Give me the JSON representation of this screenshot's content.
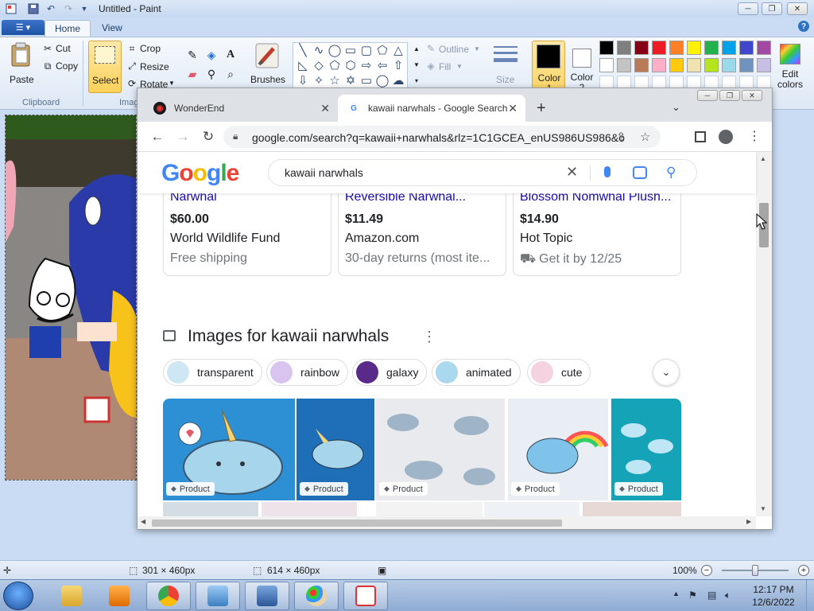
{
  "paint": {
    "title": "Untitled - Paint",
    "tabs": {
      "home": "Home",
      "view": "View"
    },
    "clipboard": {
      "paste": "Paste",
      "cut": "Cut",
      "copy": "Copy",
      "group": "Clipboard"
    },
    "image": {
      "select": "Select",
      "crop": "Crop",
      "resize": "Resize",
      "rotate": "Rotate",
      "group": "Imag"
    },
    "brushes": "Brushes",
    "outline": "Outline",
    "fill": "Fill",
    "size": "Size",
    "color1": "Color 1",
    "color2": "Color 2",
    "edit_colors": "Edit colors",
    "palette_row1": [
      "#000000",
      "#7f7f7f",
      "#880015",
      "#ed1c24",
      "#ff7f27",
      "#fff200",
      "#22b14c",
      "#00a2e8",
      "#3f48cc",
      "#a349a4"
    ],
    "palette_row2": [
      "#ffffff",
      "#c3c3c3",
      "#b97a57",
      "#ffaec9",
      "#ffc90e",
      "#efe4b0",
      "#b5e61d",
      "#99d9ea",
      "#7092be",
      "#c8bfe7"
    ],
    "status": {
      "selection_size": "301 × 460px",
      "image_size": "614 × 460px",
      "zoom": "100%"
    }
  },
  "chrome": {
    "tabs": [
      {
        "title": "WonderEnd",
        "favicon_color": "#1a1a1a"
      },
      {
        "title": "kawaii narwhals - Google Search",
        "favicon_color": "#4285f4"
      }
    ],
    "url": "google.com/search?q=kawaii+narwhals&rlz=1C1GCEA_enUS986US986&o...",
    "search_query": "kawaii narwhals",
    "products": [
      {
        "name": "Narwhal",
        "price": "$60.00",
        "store": "World Wildlife Fund",
        "note": "Free shipping"
      },
      {
        "name": "Reversible Narwhal...",
        "price": "$11.49",
        "store": "Amazon.com",
        "note": "30-day returns (most ite..."
      },
      {
        "name": "Blossom Nomwhal Plush...",
        "price": "$14.90",
        "store": "Hot Topic",
        "note": "Get it by 12/25"
      }
    ],
    "images_heading": "Images for kawaii narwhals",
    "chips": [
      {
        "label": "transparent",
        "color": "#cfe7f3"
      },
      {
        "label": "rainbow",
        "color": "#d9c4f0"
      },
      {
        "label": "galaxy",
        "color": "#5a2a8a"
      },
      {
        "label": "animated",
        "color": "#a9d8ef"
      },
      {
        "label": "cute",
        "color": "#f5d2e0"
      }
    ],
    "thumb_badge": "Product",
    "thumbs": [
      {
        "color": "#2d8fd4"
      },
      {
        "color": "#1f6fb8"
      },
      {
        "color": "#e9eaee"
      },
      {
        "color": "#e8eef4"
      },
      {
        "color": "#15a3b8"
      }
    ]
  },
  "taskbar": {
    "time": "12:17 PM",
    "date": "12/6/2022"
  }
}
